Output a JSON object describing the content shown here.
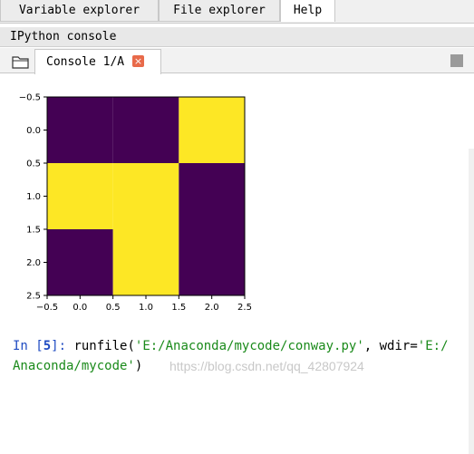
{
  "top_tabs": [
    {
      "label": "Variable explorer"
    },
    {
      "label": "File explorer"
    },
    {
      "label": "Help"
    }
  ],
  "pane_title": "IPython console",
  "console_tab": {
    "label": "Console 1/A",
    "close_glyph": "×"
  },
  "icons": {
    "folder": "folder-icon",
    "close": "close-icon",
    "stop": "stop-icon"
  },
  "colors": {
    "low": "#440154",
    "high": "#fde725",
    "prompt": "#1f4bc2",
    "string": "#1a8a1a"
  },
  "prompt": {
    "in_label": "In [",
    "number": "5",
    "in_end": "]: ",
    "code_prefix": "runfile(",
    "arg1": "'E:/Anaconda/mycode/conway.py'",
    "sep": ", wdir=",
    "arg2_part1": "'E:/",
    "arg2_part2": "Anaconda/mycode'",
    "code_suffix": ")"
  },
  "watermark": "https://blog.csdn.net/qq_42807924",
  "chart_data": {
    "type": "heatmap",
    "grid": [
      [
        0,
        0,
        1
      ],
      [
        1,
        1,
        0
      ],
      [
        0,
        1,
        0
      ]
    ],
    "x_ticks": [
      "−0.5",
      "0.0",
      "0.5",
      "1.0",
      "1.5",
      "2.0",
      "2.5"
    ],
    "y_ticks": [
      "−0.5",
      "0.0",
      "0.5",
      "1.0",
      "1.5",
      "2.0",
      "2.5"
    ],
    "xlim": [
      -0.5,
      2.5
    ],
    "ylim": [
      2.5,
      -0.5
    ],
    "colormap": "viridis",
    "grid_lines": false
  }
}
